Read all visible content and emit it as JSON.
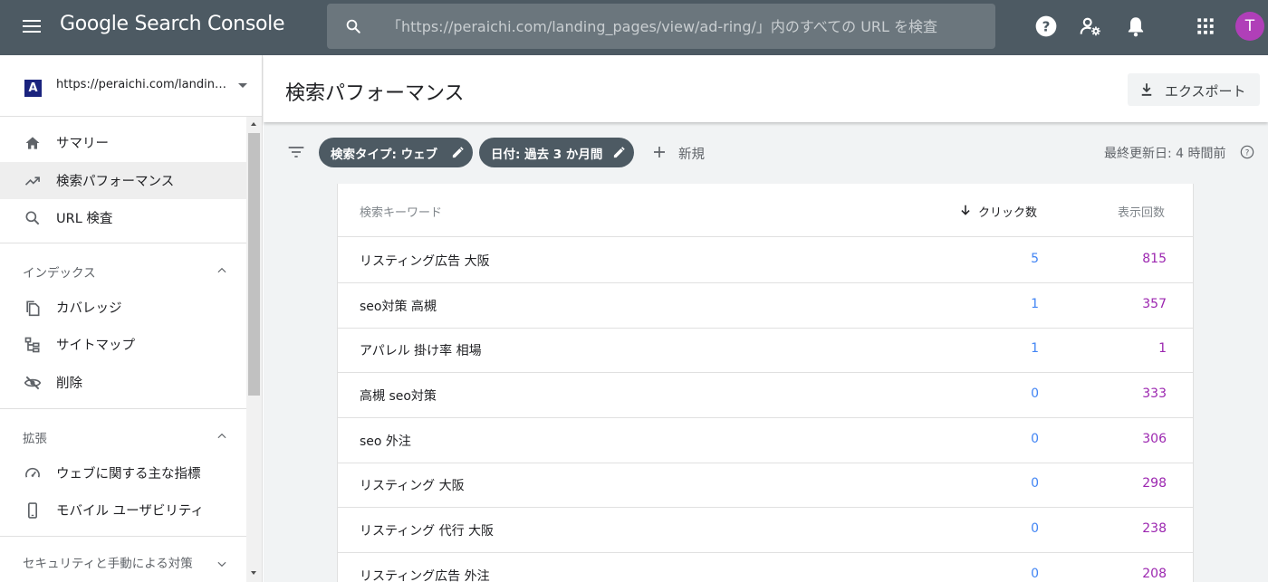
{
  "app": {
    "name": "Google Search Console",
    "avatar_letter": "T",
    "avatar_color": "#b03fb8",
    "topbar_color": "#4d5a63"
  },
  "search": {
    "placeholder": "「https://peraichi.com/landing_pages/view/ad-ring/」内のすべての URL を検査"
  },
  "top_icons": [
    "help-icon",
    "admin-settings-icon",
    "notifications-bell-icon",
    "apps-grid-icon"
  ],
  "property": {
    "favicon_letter": "A",
    "url": "https://peraichi.com/landing_pages/view/ad-ring/"
  },
  "sidebar": {
    "items": [
      {
        "label": "サマリー",
        "icon": "home-icon"
      },
      {
        "label": "検索パフォーマンス",
        "icon": "trending-up-icon",
        "active": true
      },
      {
        "label": "URL 検査",
        "icon": "search-icon"
      }
    ],
    "sections": [
      {
        "title": "インデックス",
        "items": [
          {
            "label": "カバレッジ",
            "icon": "copy-pages-icon"
          },
          {
            "label": "サイトマップ",
            "icon": "sitemap-icon"
          },
          {
            "label": "削除",
            "icon": "eye-off-icon"
          }
        ]
      },
      {
        "title": "拡張",
        "items": [
          {
            "label": "ウェブに関する主な指標",
            "icon": "speedometer-icon"
          },
          {
            "label": "モバイル ユーザビリティ",
            "icon": "smartphone-icon"
          }
        ]
      },
      {
        "title": "セキュリティと手動による対策"
      }
    ]
  },
  "page": {
    "title": "検索パフォーマンス",
    "export_label": "エクスポート"
  },
  "filters": {
    "chips": [
      "検索タイプ: ウェブ",
      "日付: 過去 3 か月間"
    ],
    "new_label": "新規",
    "updated": "最終更新日: 4 時間前"
  },
  "table": {
    "columns": {
      "query": "検索キーワード",
      "clicks": "クリック数",
      "impressions": "表示回数"
    },
    "sort": "clicks-desc",
    "clicks_color": "#4285f4",
    "impressions_color": "#9c27b0",
    "rows": [
      {
        "query": "リスティング広告 大阪",
        "clicks": "5",
        "impressions": "815"
      },
      {
        "query": "seo対策 高槻",
        "clicks": "1",
        "impressions": "357"
      },
      {
        "query": "アパレル 掛け率 相場",
        "clicks": "1",
        "impressions": "1"
      },
      {
        "query": "高槻 seo対策",
        "clicks": "0",
        "impressions": "333"
      },
      {
        "query": "seo 外注",
        "clicks": "0",
        "impressions": "306"
      },
      {
        "query": "リスティング 大阪",
        "clicks": "0",
        "impressions": "298"
      },
      {
        "query": "リスティング 代行 大阪",
        "clicks": "0",
        "impressions": "238"
      },
      {
        "query": "リスティング広告 外注",
        "clicks": "0",
        "impressions": "208"
      }
    ]
  }
}
